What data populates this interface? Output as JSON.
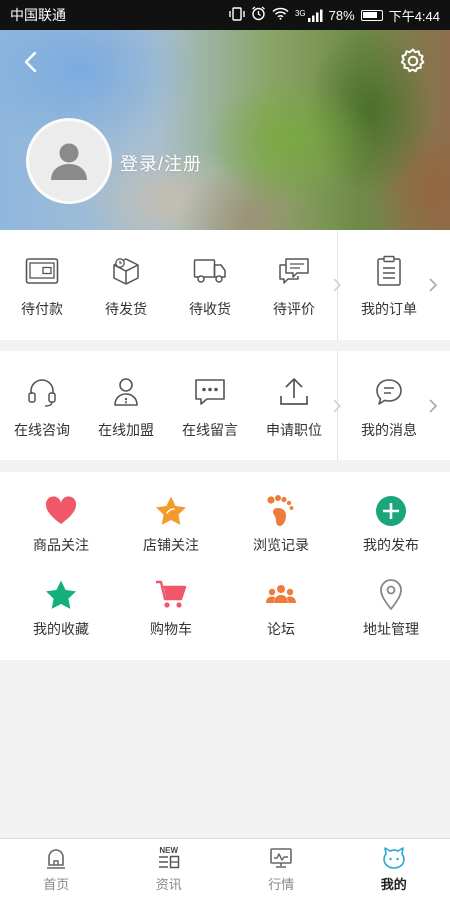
{
  "status_bar": {
    "carrier": "中国联通",
    "battery": "78%",
    "time": "下午4:44",
    "network": "3G"
  },
  "header": {
    "login_text": "登录/注册"
  },
  "orders": {
    "items": [
      {
        "label": "待付款",
        "icon": "wallet-icon"
      },
      {
        "label": "待发货",
        "icon": "package-icon"
      },
      {
        "label": "待收货",
        "icon": "truck-icon"
      },
      {
        "label": "待评价",
        "icon": "comment-icon"
      }
    ],
    "summary": {
      "label": "我的订单",
      "icon": "clipboard-icon"
    }
  },
  "services": {
    "items": [
      {
        "label": "在线咨询",
        "icon": "headset-icon"
      },
      {
        "label": "在线加盟",
        "icon": "user-info-icon"
      },
      {
        "label": "在线留言",
        "icon": "message-dots-icon"
      },
      {
        "label": "申请职位",
        "icon": "upload-icon"
      }
    ],
    "summary": {
      "label": "我的消息",
      "icon": "chat-bubble-icon"
    }
  },
  "features": [
    {
      "label": "商品关注",
      "icon": "heart-icon",
      "color": "#f0586a"
    },
    {
      "label": "店铺关注",
      "icon": "star-icon",
      "color": "#f39a2a"
    },
    {
      "label": "浏览记录",
      "icon": "footprint-icon",
      "color": "#f07a3a"
    },
    {
      "label": "我的发布",
      "icon": "plus-circle-icon",
      "color": "#1aa57a"
    },
    {
      "label": "我的收藏",
      "icon": "star-filled-icon",
      "color": "#14b07a"
    },
    {
      "label": "购物车",
      "icon": "cart-icon",
      "color": "#f0586a"
    },
    {
      "label": "论坛",
      "icon": "group-icon",
      "color": "#f07a3a"
    },
    {
      "label": "地址管理",
      "icon": "location-pin-icon",
      "color": "#888888"
    }
  ],
  "bottom_nav": [
    {
      "label": "首页",
      "icon": "home-icon"
    },
    {
      "label": "资讯",
      "icon": "news-icon",
      "badge": "NEW"
    },
    {
      "label": "行情",
      "icon": "monitor-chart-icon"
    },
    {
      "label": "我的",
      "icon": "profile-icon",
      "active": true
    }
  ],
  "colors": {
    "accent": "#2aa7d6",
    "icon_gray": "#555555"
  }
}
